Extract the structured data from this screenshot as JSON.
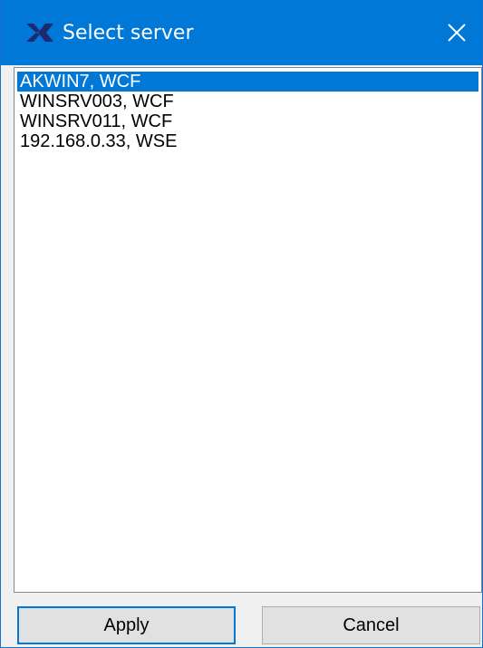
{
  "window": {
    "title": "Select server",
    "icon": "app-logo-icon",
    "close_icon": "close-icon",
    "accent_color": "#0078d7"
  },
  "server_list": {
    "selected_index": 0,
    "items": [
      {
        "label": "AKWIN7, WCF"
      },
      {
        "label": "WINSRV003, WCF"
      },
      {
        "label": "WINSRV011, WCF"
      },
      {
        "label": "192.168.0.33, WSE"
      }
    ]
  },
  "buttons": {
    "apply_label": "Apply",
    "cancel_label": "Cancel"
  }
}
